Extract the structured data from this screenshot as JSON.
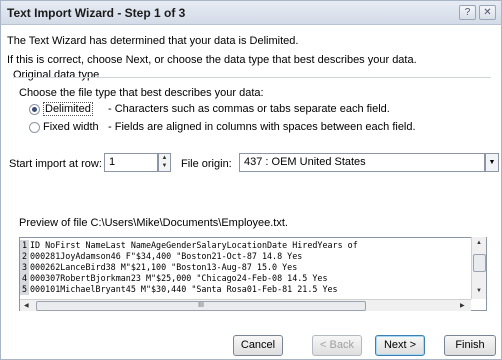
{
  "window": {
    "title": "Text Import Wizard - Step 1 of 3",
    "help_glyph": "?",
    "close_glyph": "✕"
  },
  "intro": {
    "line1": "The Text Wizard has determined that your data is Delimited.",
    "line2": "If this is correct, choose Next, or choose the data type that best describes your data."
  },
  "data_type": {
    "group_label": "Original data type",
    "prompt": "Choose the file type that best describes your data:",
    "options": [
      {
        "label": "Delimited",
        "description": "- Characters such as commas or tabs separate each field.",
        "selected": true
      },
      {
        "label": "Fixed width",
        "description": "- Fields are aligned in columns with spaces between each field.",
        "selected": false
      }
    ]
  },
  "start_row": {
    "label": "Start import at row:",
    "value": "1"
  },
  "file_origin": {
    "label": "File origin:",
    "value": "437 : OEM United States"
  },
  "preview": {
    "label": "Preview of file C:\\Users\\Mike\\Documents\\Employee.txt.",
    "rows": [
      {
        "num": "1",
        "text": "ID NoFirst NameLast NameAgeGenderSalaryLocationDate HiredYears of"
      },
      {
        "num": "2",
        "text": "000281JoyAdamson46 F\"$34,400 \"Boston21-Oct-87 14.8 Yes"
      },
      {
        "num": "3",
        "text": "000262LanceBird38 M\"$21,100 \"Boston13-Aug-87 15.0 Yes"
      },
      {
        "num": "4",
        "text": "000307RobertBjorkman23 M\"$25,000 \"Chicago24-Feb-08 14.5 Yes"
      },
      {
        "num": "5",
        "text": "000101MichaelBryant45 M\"$30,440 \"Santa Rosa01-Feb-81 21.5 Yes"
      }
    ]
  },
  "buttons": {
    "cancel": "Cancel",
    "back": "< Back",
    "next": "Next >",
    "finish": "Finish"
  },
  "icons": {
    "spin_up": "▲",
    "spin_down": "▼",
    "dropdown": "▼",
    "scroll_up": "▲",
    "scroll_down": "▼",
    "scroll_left": "◀",
    "scroll_right": "▶",
    "grip": "III"
  }
}
